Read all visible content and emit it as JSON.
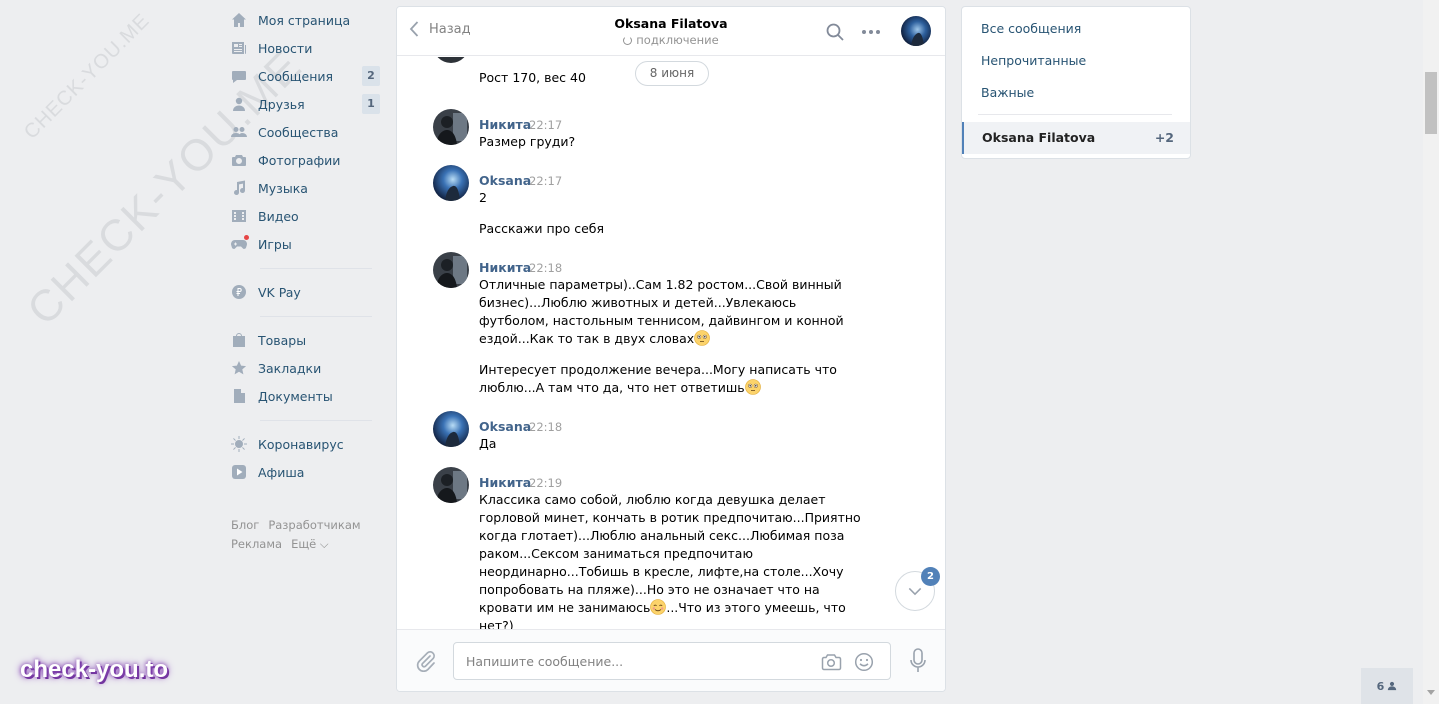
{
  "watermark": {
    "main": "CHECK-YOU.ME",
    "small": "CHECK-YOU.ME",
    "badge": "check-you.to"
  },
  "nav": {
    "items": [
      {
        "icon": "home-icon",
        "label": "Моя страница"
      },
      {
        "icon": "news-icon",
        "label": "Новости"
      },
      {
        "icon": "messages-icon",
        "label": "Сообщения",
        "count": "2"
      },
      {
        "icon": "friends-icon",
        "label": "Друзья",
        "count": "1"
      },
      {
        "icon": "groups-icon",
        "label": "Сообщества"
      },
      {
        "icon": "camera-icon",
        "label": "Фотографии"
      },
      {
        "icon": "music-icon",
        "label": "Музыка"
      },
      {
        "icon": "video-icon",
        "label": "Видео"
      },
      {
        "icon": "gamepad-icon",
        "label": "Игры"
      }
    ],
    "pay": {
      "icon": "ruble-icon",
      "label": "VK Pay"
    },
    "extra": [
      {
        "icon": "bag-icon",
        "label": "Товары"
      },
      {
        "icon": "star-icon",
        "label": "Закладки"
      },
      {
        "icon": "document-icon",
        "label": "Документы"
      }
    ],
    "misc": [
      {
        "icon": "virus-icon",
        "label": "Коронавирус"
      },
      {
        "icon": "play-icon",
        "label": "Афиша"
      }
    ],
    "footer": {
      "blog": "Блог",
      "developers": "Разработчикам",
      "ads": "Реклама",
      "more": "Ещё ⌵"
    }
  },
  "chat": {
    "back_label": "Назад",
    "peer_name": "Oksana Filatova",
    "peer_status": "подключение",
    "date_label": "8 июня",
    "messages": [
      {
        "text": "Рост 170, вес 40"
      },
      {
        "author": "Никита",
        "time": "22:17",
        "text": "Размер груди?"
      },
      {
        "author": "Oksana",
        "time": "22:17",
        "text": "2"
      },
      {
        "text": "Расскажи про себя"
      },
      {
        "author": "Никита",
        "time": "22:18",
        "text": "Отличные параметры)..Сам 1.82 ростом...Свой винный бизнес)...Люблю животных и детей...Увлекаюсь футболом, настольным теннисом, дайвингом и конной ездой...Как то так в двух словах"
      },
      {
        "text": "Интересует продолжение вечера...Могу написать что люблю...А там что да, что нет ответишь"
      },
      {
        "author": "Oksana",
        "time": "22:18",
        "text": "Да"
      },
      {
        "author": "Никита",
        "time": "22:19",
        "text_a": "Классика само собой, люблю когда девушка делает горловой минет, кончать в ротик предпочитаю...Приятно когда глотает)...Люблю анальный секс...Любимая поза раком...Сексом заниматься предпочитаю неординарно...Тобишь в кресле, лифте,на столе...Хочу попробовать на пляже)...Но это не означает что на кровати им не занимаюсь",
        "text_b": "...Что из этого умеешь, что нет?)"
      }
    ],
    "unread_badge": "2",
    "composer_placeholder": "Напишите сообщение..."
  },
  "filters": {
    "all": "Все сообщения",
    "unread": "Непрочитанные",
    "important": "Важные",
    "active_name": "Oksana Filatova",
    "active_count": "+2"
  },
  "online_count": "6",
  "colors": {
    "link": "#285473",
    "author": "#42648b",
    "accent": "#5181b8",
    "page_bg": "#edeef0"
  }
}
